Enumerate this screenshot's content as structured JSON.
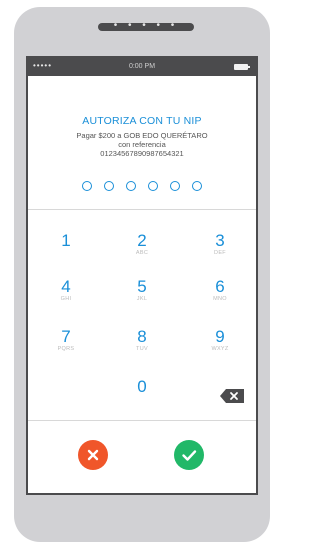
{
  "speaker": {
    "dots": "• • • • •"
  },
  "statusbar": {
    "signal": "•••••",
    "time": "0:00 PM"
  },
  "auth": {
    "title": "AUTORIZA CON TU NIP",
    "line1": "Pagar $200 a GOB EDO QUERÉTARO",
    "line2": "con referencia",
    "line3": "01234567890987654321"
  },
  "pin_length": 6,
  "keypad": {
    "keys": [
      {
        "digit": "1",
        "letters": ""
      },
      {
        "digit": "2",
        "letters": "ABC"
      },
      {
        "digit": "3",
        "letters": "DEF"
      },
      {
        "digit": "4",
        "letters": "GHI"
      },
      {
        "digit": "5",
        "letters": "JKL"
      },
      {
        "digit": "6",
        "letters": "MNO"
      },
      {
        "digit": "7",
        "letters": "PQRS"
      },
      {
        "digit": "8",
        "letters": "TUV"
      },
      {
        "digit": "9",
        "letters": "WXYZ"
      },
      {
        "digit": "0",
        "letters": ""
      }
    ]
  },
  "colors": {
    "accent": "#1a8fd8",
    "cancel": "#f0562a",
    "confirm": "#21b868",
    "frame": "#d1d1d4",
    "bezel": "#4b4b4d"
  },
  "icons": {
    "cancel": "close-icon",
    "confirm": "check-icon",
    "backspace": "backspace-icon"
  }
}
